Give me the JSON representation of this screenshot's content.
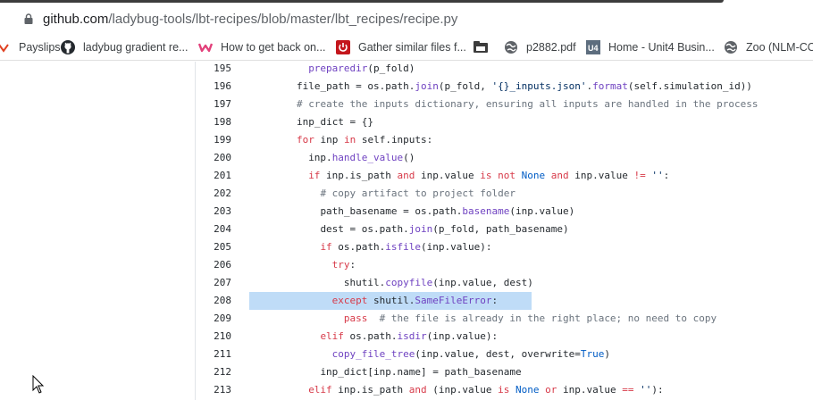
{
  "browser": {
    "url_host": "github.com",
    "url_path": "/ladybug-tools/lbt-recipes/blob/master/lbt_recipes/recipe.py"
  },
  "bookmarks": [
    {
      "label": "Payslips",
      "icon": "payslips-icon"
    },
    {
      "label": "ladybug gradient re...",
      "icon": "github-icon"
    },
    {
      "label": "How to get back on...",
      "icon": "w-logo-icon"
    },
    {
      "label": "Gather similar files f...",
      "icon": "power-icon"
    },
    {
      "label": "p2882.pdf",
      "icon": "globe-icon"
    },
    {
      "label": "Home - Unit4 Busin...",
      "icon": "u4-icon"
    },
    {
      "label": "Zoo (NLM-CO",
      "icon": "globe-icon"
    }
  ],
  "code": {
    "highlight_line": "208",
    "lines": [
      {
        "n": "195",
        "indent": 10,
        "tokens": [
          {
            "t": "preparedir",
            "c": "f"
          },
          {
            "t": "(p_fold)"
          }
        ]
      },
      {
        "n": "196",
        "indent": 8,
        "tokens": [
          {
            "t": "file_path = os.path."
          },
          {
            "t": "join",
            "c": "f"
          },
          {
            "t": "(p_fold, "
          },
          {
            "t": "'{}_inputs.json'",
            "c": "s"
          },
          {
            "t": "."
          },
          {
            "t": "format",
            "c": "f"
          },
          {
            "t": "(self.simulation_id))"
          }
        ]
      },
      {
        "n": "197",
        "indent": 8,
        "tokens": [
          {
            "t": "# create the inputs dictionary, ensuring all inputs are handled in the process",
            "c": "c"
          }
        ]
      },
      {
        "n": "198",
        "indent": 8,
        "tokens": [
          {
            "t": "inp_dict = {}"
          }
        ]
      },
      {
        "n": "199",
        "indent": 8,
        "tokens": [
          {
            "t": "for",
            "c": "k"
          },
          {
            "t": " inp "
          },
          {
            "t": "in",
            "c": "k"
          },
          {
            "t": " self.inputs:"
          }
        ]
      },
      {
        "n": "200",
        "indent": 10,
        "tokens": [
          {
            "t": "inp."
          },
          {
            "t": "handle_value",
            "c": "f"
          },
          {
            "t": "()"
          }
        ]
      },
      {
        "n": "201",
        "indent": 10,
        "tokens": [
          {
            "t": "if",
            "c": "k"
          },
          {
            "t": " inp.is_path "
          },
          {
            "t": "and",
            "c": "k"
          },
          {
            "t": " inp.value "
          },
          {
            "t": "is not",
            "c": "k"
          },
          {
            "t": " "
          },
          {
            "t": "None",
            "c": "b"
          },
          {
            "t": " "
          },
          {
            "t": "and",
            "c": "k"
          },
          {
            "t": " inp.value "
          },
          {
            "t": "!=",
            "c": "k"
          },
          {
            "t": " "
          },
          {
            "t": "''",
            "c": "s"
          },
          {
            "t": ":"
          }
        ]
      },
      {
        "n": "202",
        "indent": 12,
        "tokens": [
          {
            "t": "# copy artifact to project folder",
            "c": "c"
          }
        ]
      },
      {
        "n": "203",
        "indent": 12,
        "tokens": [
          {
            "t": "path_basename = os.path."
          },
          {
            "t": "basename",
            "c": "f"
          },
          {
            "t": "(inp.value)"
          }
        ]
      },
      {
        "n": "204",
        "indent": 12,
        "tokens": [
          {
            "t": "dest = os.path."
          },
          {
            "t": "join",
            "c": "f"
          },
          {
            "t": "(p_fold, path_basename)"
          }
        ]
      },
      {
        "n": "205",
        "indent": 12,
        "tokens": [
          {
            "t": "if",
            "c": "k"
          },
          {
            "t": " os.path."
          },
          {
            "t": "isfile",
            "c": "f"
          },
          {
            "t": "(inp.value):"
          }
        ]
      },
      {
        "n": "206",
        "indent": 14,
        "tokens": [
          {
            "t": "try",
            "c": "k"
          },
          {
            "t": ":"
          }
        ]
      },
      {
        "n": "207",
        "indent": 16,
        "tokens": [
          {
            "t": "shutil."
          },
          {
            "t": "copyfile",
            "c": "f"
          },
          {
            "t": "(inp.value, dest)"
          }
        ]
      },
      {
        "n": "208",
        "indent": 14,
        "tokens": [
          {
            "t": "except",
            "c": "k"
          },
          {
            "t": " shutil."
          },
          {
            "t": "SameFileError",
            "c": "f"
          },
          {
            "t": ":"
          }
        ]
      },
      {
        "n": "209",
        "indent": 16,
        "tokens": [
          {
            "t": "pass",
            "c": "k"
          },
          {
            "t": "  "
          },
          {
            "t": "# the file is already in the right place; no need to copy",
            "c": "c"
          }
        ]
      },
      {
        "n": "210",
        "indent": 12,
        "tokens": [
          {
            "t": "elif",
            "c": "k"
          },
          {
            "t": " os.path."
          },
          {
            "t": "isdir",
            "c": "f"
          },
          {
            "t": "(inp.value):"
          }
        ]
      },
      {
        "n": "211",
        "indent": 14,
        "tokens": [
          {
            "t": "copy_file_tree",
            "c": "f"
          },
          {
            "t": "(inp.value, dest, overwrite="
          },
          {
            "t": "True",
            "c": "b"
          },
          {
            "t": ")"
          }
        ]
      },
      {
        "n": "212",
        "indent": 12,
        "tokens": [
          {
            "t": "inp_dict[inp.name] = path_basename"
          }
        ]
      },
      {
        "n": "213",
        "indent": 10,
        "tokens": [
          {
            "t": "elif",
            "c": "k"
          },
          {
            "t": " inp.is_path "
          },
          {
            "t": "and",
            "c": "k"
          },
          {
            "t": " (inp.value "
          },
          {
            "t": "is",
            "c": "k"
          },
          {
            "t": " "
          },
          {
            "t": "None",
            "c": "b"
          },
          {
            "t": " "
          },
          {
            "t": "or",
            "c": "k"
          },
          {
            "t": " inp.value "
          },
          {
            "t": "==",
            "c": "k"
          },
          {
            "t": " "
          },
          {
            "t": "''",
            "c": "s"
          },
          {
            "t": "):"
          }
        ]
      }
    ]
  }
}
